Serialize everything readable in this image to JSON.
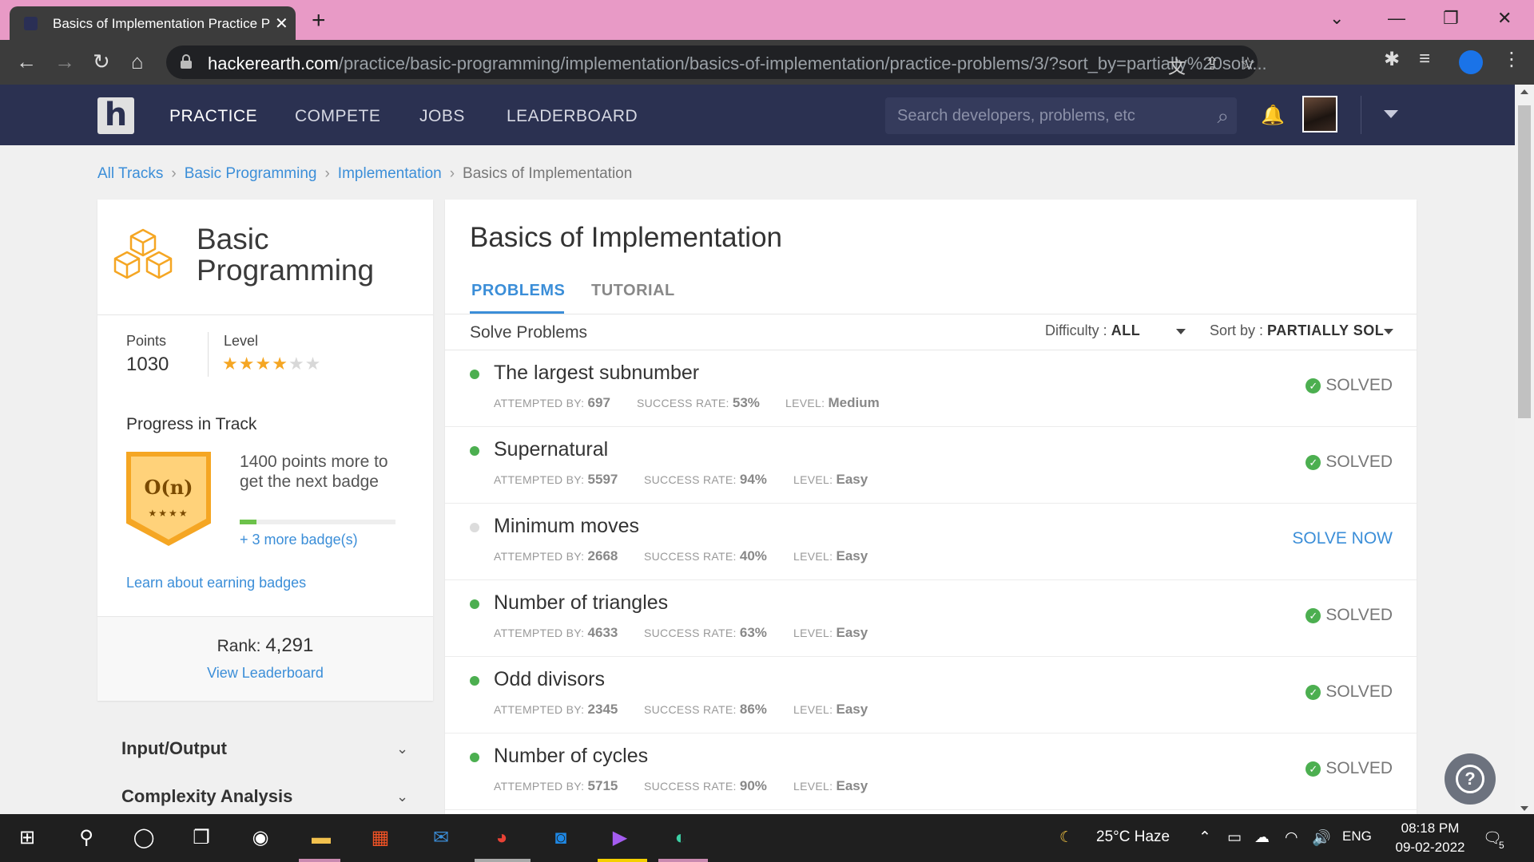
{
  "browser": {
    "tab_title": "Basics of Implementation Practice Problems",
    "url_domain": "hackerearth.com",
    "url_path": "/practice/basic-programming/implementation/basics-of-implementation/practice-problems/3/?sort_by=partially%20solv..."
  },
  "nav": {
    "logo": "h",
    "practice": "PRACTICE",
    "compete": "COMPETE",
    "jobs": "JOBS",
    "leaderboard": "LEADERBOARD",
    "search_placeholder": "Search developers, problems, etc"
  },
  "breadcrumb": [
    "All Tracks",
    "Basic Programming",
    "Implementation",
    "Basics of Implementation"
  ],
  "track": {
    "title": "Basic Programming",
    "points_label": "Points",
    "points": "1030",
    "level_label": "Level",
    "level_stars": 4,
    "level_max": 6,
    "progress_label": "Progress in Track",
    "badge_text": "O(n)",
    "badge_stars": "★★★★",
    "next_badge_text": "1400 points more to get the next badge",
    "progress_fraction": 0.11,
    "more_badges": "+ 3 more badge(s)",
    "learn_link": "Learn about earning badges",
    "rank_label": "Rank:",
    "rank_value": "4,291",
    "view_leaderboard": "View Leaderboard"
  },
  "topics": [
    "Input/Output",
    "Complexity Analysis"
  ],
  "main": {
    "title": "Basics of Implementation",
    "tab_problems": "PROBLEMS",
    "tab_tutorial": "TUTORIAL",
    "solve_problems": "Solve Problems",
    "difficulty_label": "Difficulty :",
    "difficulty_value": "ALL",
    "sort_label": "Sort by :",
    "sort_value": "PARTIALLY SOL",
    "attempted_label": "ATTEMPTED BY:",
    "success_label": "SUCCESS RATE:",
    "level_label": "LEVEL:"
  },
  "problems": [
    {
      "name": "The largest subnumber",
      "attempted": "697",
      "success": "53%",
      "level": "Medium",
      "status": "SOLVED",
      "solved": true
    },
    {
      "name": "Supernatural",
      "attempted": "5597",
      "success": "94%",
      "level": "Easy",
      "status": "SOLVED",
      "solved": true
    },
    {
      "name": "Minimum moves",
      "attempted": "2668",
      "success": "40%",
      "level": "Easy",
      "status": "SOLVE NOW",
      "solved": false
    },
    {
      "name": "Number of triangles",
      "attempted": "4633",
      "success": "63%",
      "level": "Easy",
      "status": "SOLVED",
      "solved": true
    },
    {
      "name": "Odd divisors",
      "attempted": "2345",
      "success": "86%",
      "level": "Easy",
      "status": "SOLVED",
      "solved": true
    },
    {
      "name": "Number of cycles",
      "attempted": "5715",
      "success": "90%",
      "level": "Easy",
      "status": "SOLVED",
      "solved": true
    }
  ],
  "taskbar": {
    "weather": "25°C  Haze",
    "lang": "ENG",
    "time": "08:18 PM",
    "date": "09-02-2022",
    "notif_count": "5"
  },
  "colors": {
    "header_bg": "#2b3151",
    "link": "#3b8ed8",
    "solved_green": "#4caf50",
    "star_gold": "#f5a623",
    "tabstrip_pink": "#e89ac6"
  }
}
